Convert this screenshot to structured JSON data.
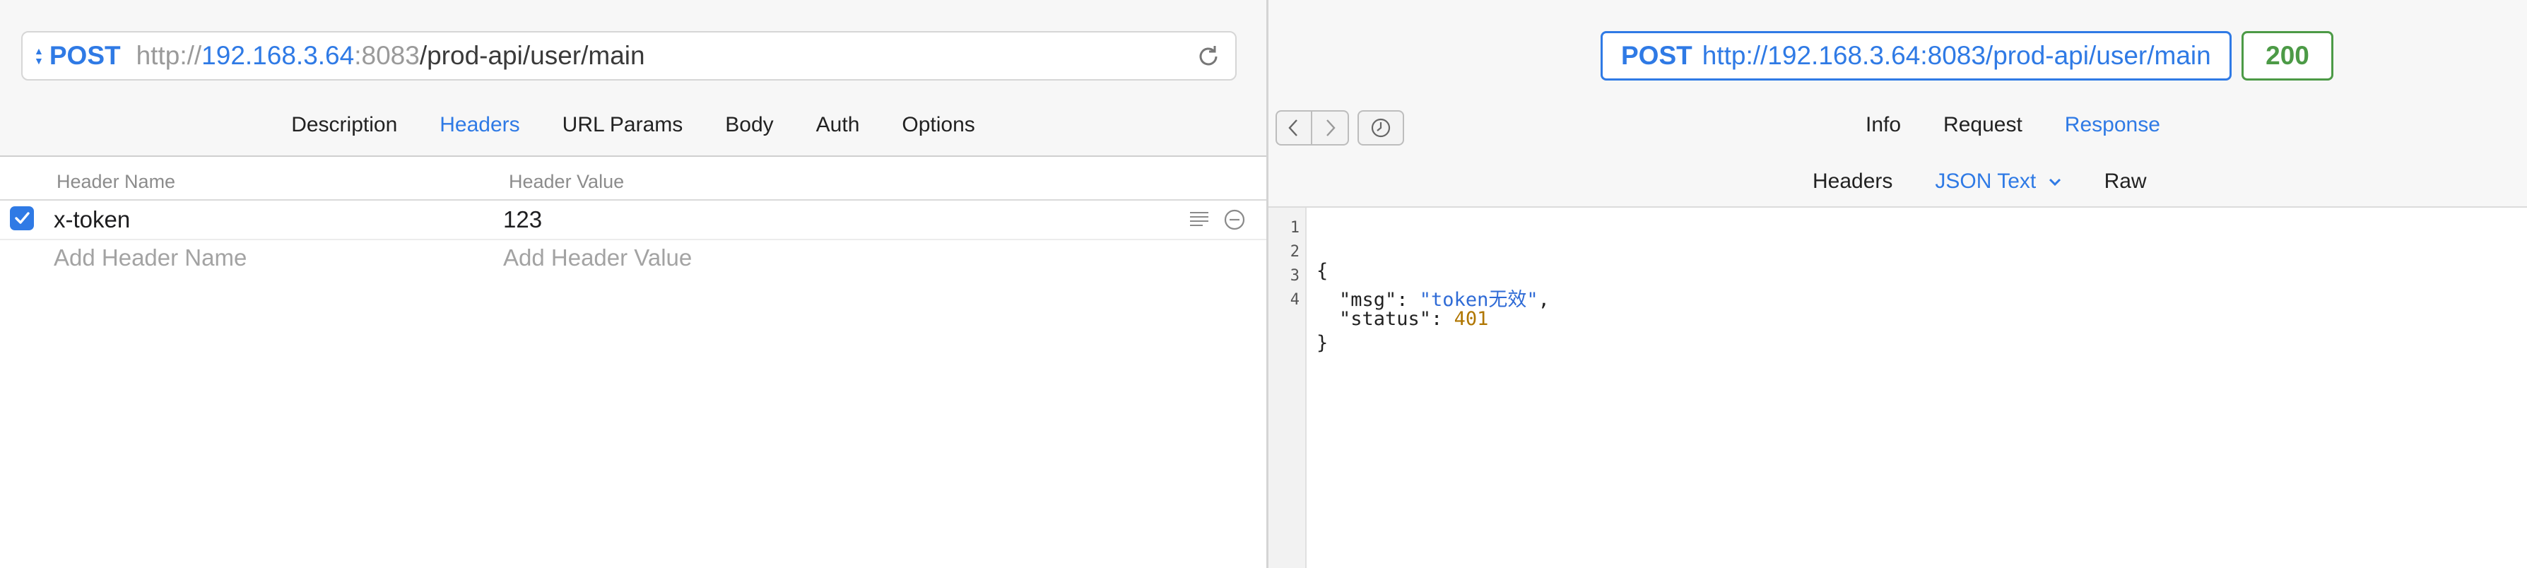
{
  "request": {
    "method": "POST",
    "url_parts": {
      "scheme": "http://",
      "host": "192.168.3.64",
      "port": ":8083",
      "path": "/prod-api/user/main"
    },
    "tabs": [
      "Description",
      "Headers",
      "URL Params",
      "Body",
      "Auth",
      "Options"
    ],
    "active_tab": "Headers",
    "headers_table": {
      "col_name": "Header Name",
      "col_value": "Header Value",
      "rows": [
        {
          "enabled": true,
          "name": "x-token",
          "value": "123"
        }
      ],
      "add_name_placeholder": "Add Header Name",
      "add_value_placeholder": "Add Header Value"
    }
  },
  "response": {
    "summary_method": "POST",
    "summary_url": "http://192.168.3.64:8083/prod-api/user/main",
    "status_code": "200",
    "tabs": [
      "Info",
      "Request",
      "Response"
    ],
    "active_tab": "Response",
    "subtabs": [
      "Headers",
      "JSON Text",
      "Raw"
    ],
    "active_subtab": "JSON Text",
    "body_lines": [
      {
        "num": "1",
        "text": "{"
      },
      {
        "num": "2",
        "key": "\"msg\"",
        "value": "\"token无效\"",
        "suffix": ","
      },
      {
        "num": "3",
        "key": "\"status\"",
        "value": "401",
        "suffix": ""
      },
      {
        "num": "4",
        "text": "}"
      }
    ]
  },
  "icons": {
    "reload": "reload-icon",
    "back": "chevron-left-icon",
    "forward": "chevron-right-icon",
    "history": "clock-icon",
    "row_description": "lines-icon",
    "row_delete": "minus-circle-icon",
    "check": "checkmark-icon"
  },
  "colors": {
    "accent": "#2f7ae5",
    "status_ok": "#4c9a46",
    "json_string": "#2f6bd6",
    "json_number": "#b07600"
  }
}
